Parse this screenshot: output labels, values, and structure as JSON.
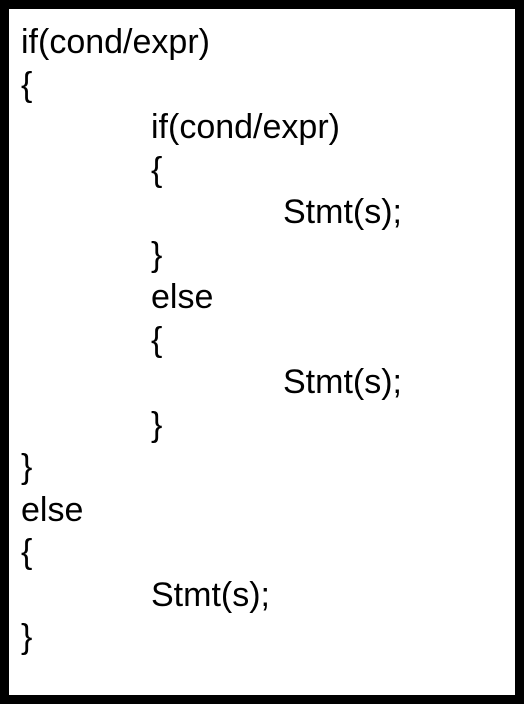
{
  "lines": {
    "l0": "if(cond/expr)",
    "l1": "{",
    "l2": "if(cond/expr)",
    "l3": "{",
    "l4": "Stmt(s);",
    "l5": "}",
    "l6": "else",
    "l7": "{",
    "l8": "Stmt(s);",
    "l9": "}",
    "l10": "}",
    "l11": "else",
    "l12": "{",
    "l13": "Stmt(s);",
    "l14": "}"
  }
}
